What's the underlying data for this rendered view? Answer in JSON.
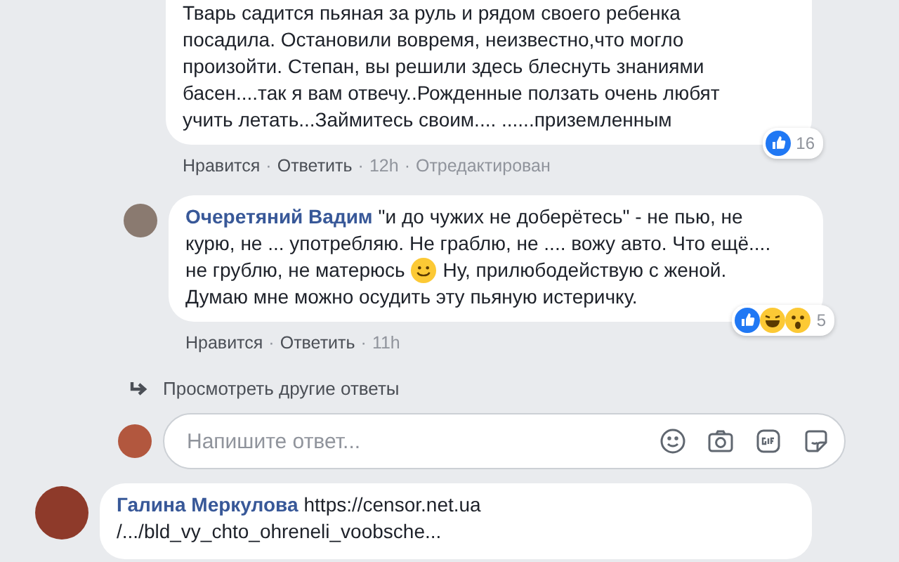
{
  "replies": [
    {
      "kind": "cut",
      "segments": [
        {
          "kind": "text",
          "text": "Тварь садится пьяная за руль и рядом своего ребенка посадила. Остановили вовремя, неизвестно,что могло произойти. Степан, вы решили здесь блеснуть знаниями басен....так я вам отвечу..Рожденные ползать очень любят учить летать...Займитесь своим.... ......приземленным"
        }
      ],
      "actions": [
        "Нравится",
        "Ответить"
      ],
      "meta": [
        "12h",
        "Отредактирован"
      ],
      "reactions": [
        {
          "kind": "like"
        }
      ],
      "reaction_count": "16"
    },
    {
      "kind": "full",
      "author": "Очеретяний Вадим",
      "segments": [
        {
          "kind": "text",
          "text": "\"и до чужих не доберётесь\" - не пью, не курю, не ... употребляю. Не граблю, не .... вожу авто. Что ещё.... не грублю, не матерюсь"
        },
        {
          "kind": "emoji"
        },
        {
          "kind": "text",
          "text": "Ну, прилюбодействую с женой. Думаю мне можно осудить эту пьяную истеричку."
        }
      ],
      "actions": [
        "Нравится",
        "Ответить"
      ],
      "meta": [
        "11h"
      ],
      "reactions": [
        {
          "kind": "like"
        },
        {
          "kind": "haha"
        },
        {
          "kind": "wow"
        }
      ],
      "reaction_count": "5"
    }
  ],
  "separator": "·",
  "more_replies": "Просмотреть другие ответы",
  "reply_box": {
    "placeholder": "Напишите ответ..."
  },
  "next_comment": {
    "author": "Галина Меркулова",
    "link_lines": [
      "https://censor.net.ua",
      "/.../bld_vy_chto_ohreneli_voobsche..."
    ]
  }
}
